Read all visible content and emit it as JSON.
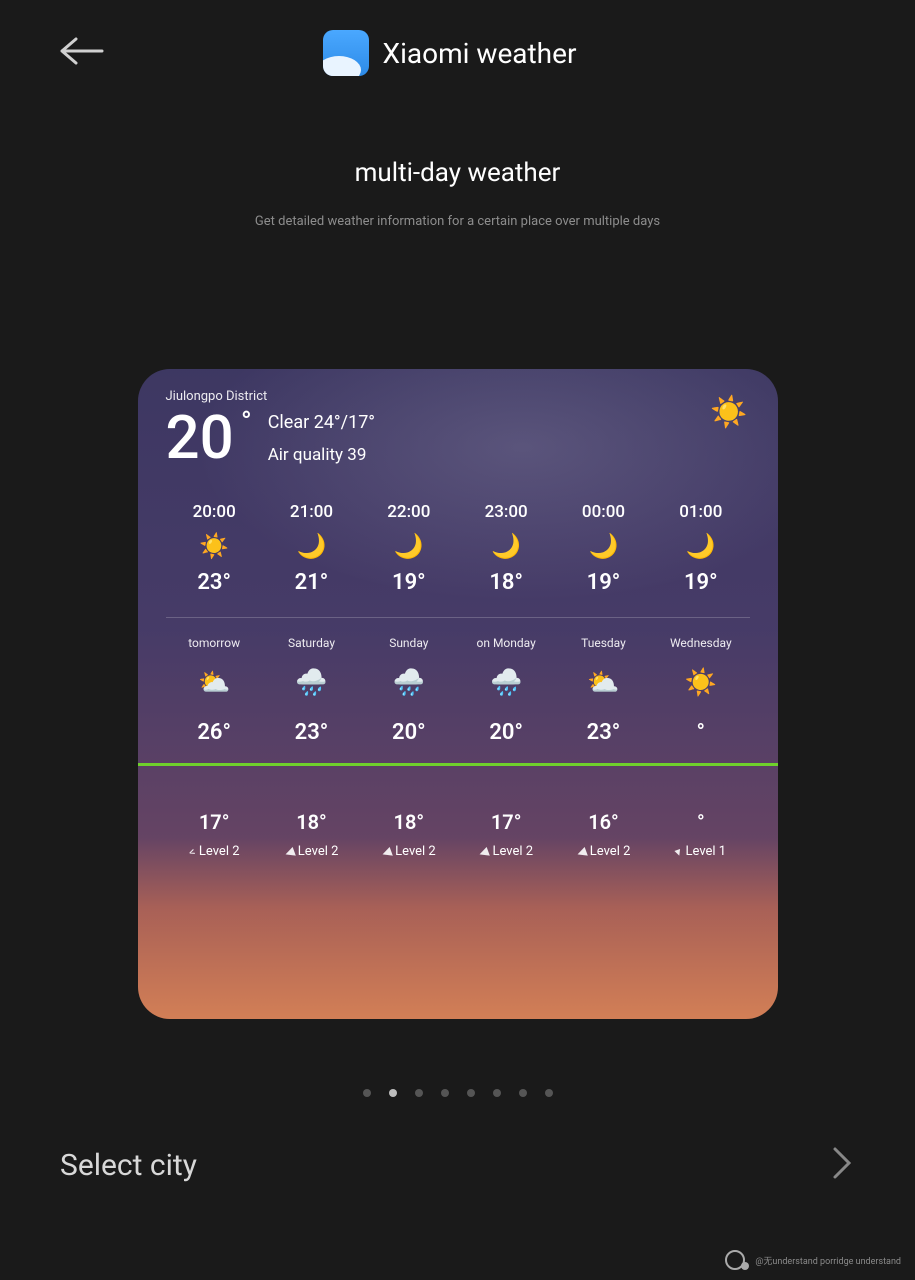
{
  "header": {
    "title": "Xiaomi weather"
  },
  "page": {
    "subtitle": "multi-day weather",
    "description": "Get detailed weather information for a certain place over multiple days"
  },
  "card": {
    "district": "Jiulongpo District",
    "temp": "20",
    "condition": "Clear 24°/17°",
    "air_quality": "Air quality 39",
    "top_icon": "☀️",
    "hourly": [
      {
        "time": "20:00",
        "icon": "☀️",
        "temp": "23°"
      },
      {
        "time": "21:00",
        "icon": "🌙",
        "temp": "21°"
      },
      {
        "time": "22:00",
        "icon": "🌙",
        "temp": "19°"
      },
      {
        "time": "23:00",
        "icon": "🌙",
        "temp": "18°"
      },
      {
        "time": "00:00",
        "icon": "🌙",
        "temp": "19°"
      },
      {
        "time": "01:00",
        "icon": "🌙",
        "temp": "19°"
      }
    ],
    "daily": [
      {
        "day": "tomorrow",
        "icon": "⛅",
        "high": "26°",
        "low": "17°",
        "wind_prefix": "<",
        "wind": "Level 2"
      },
      {
        "day": "Saturday",
        "icon": "🌧️",
        "high": "23°",
        "low": "18°",
        "wind_prefix": "◀",
        "wind": "Level 2"
      },
      {
        "day": "Sunday",
        "icon": "🌧️",
        "high": "20°",
        "low": "18°",
        "wind_prefix": "◀",
        "wind": "Level 2"
      },
      {
        "day": "on Monday",
        "icon": "🌧️",
        "high": "20°",
        "low": "17°",
        "wind_prefix": "◀",
        "wind": "Level 2"
      },
      {
        "day": "Tuesday",
        "icon": "⛅",
        "high": "23°",
        "low": "16°",
        "wind_prefix": "◀",
        "wind": "Level 2"
      },
      {
        "day": "Wednesday",
        "icon": "☀️",
        "high": "°",
        "low": "°",
        "wind_prefix": "▾",
        "wind": "Level 1"
      }
    ]
  },
  "pager": {
    "count": 8,
    "active": 1
  },
  "footer": {
    "select_city": "Select city"
  },
  "watermark": "@无understand porridge understand"
}
